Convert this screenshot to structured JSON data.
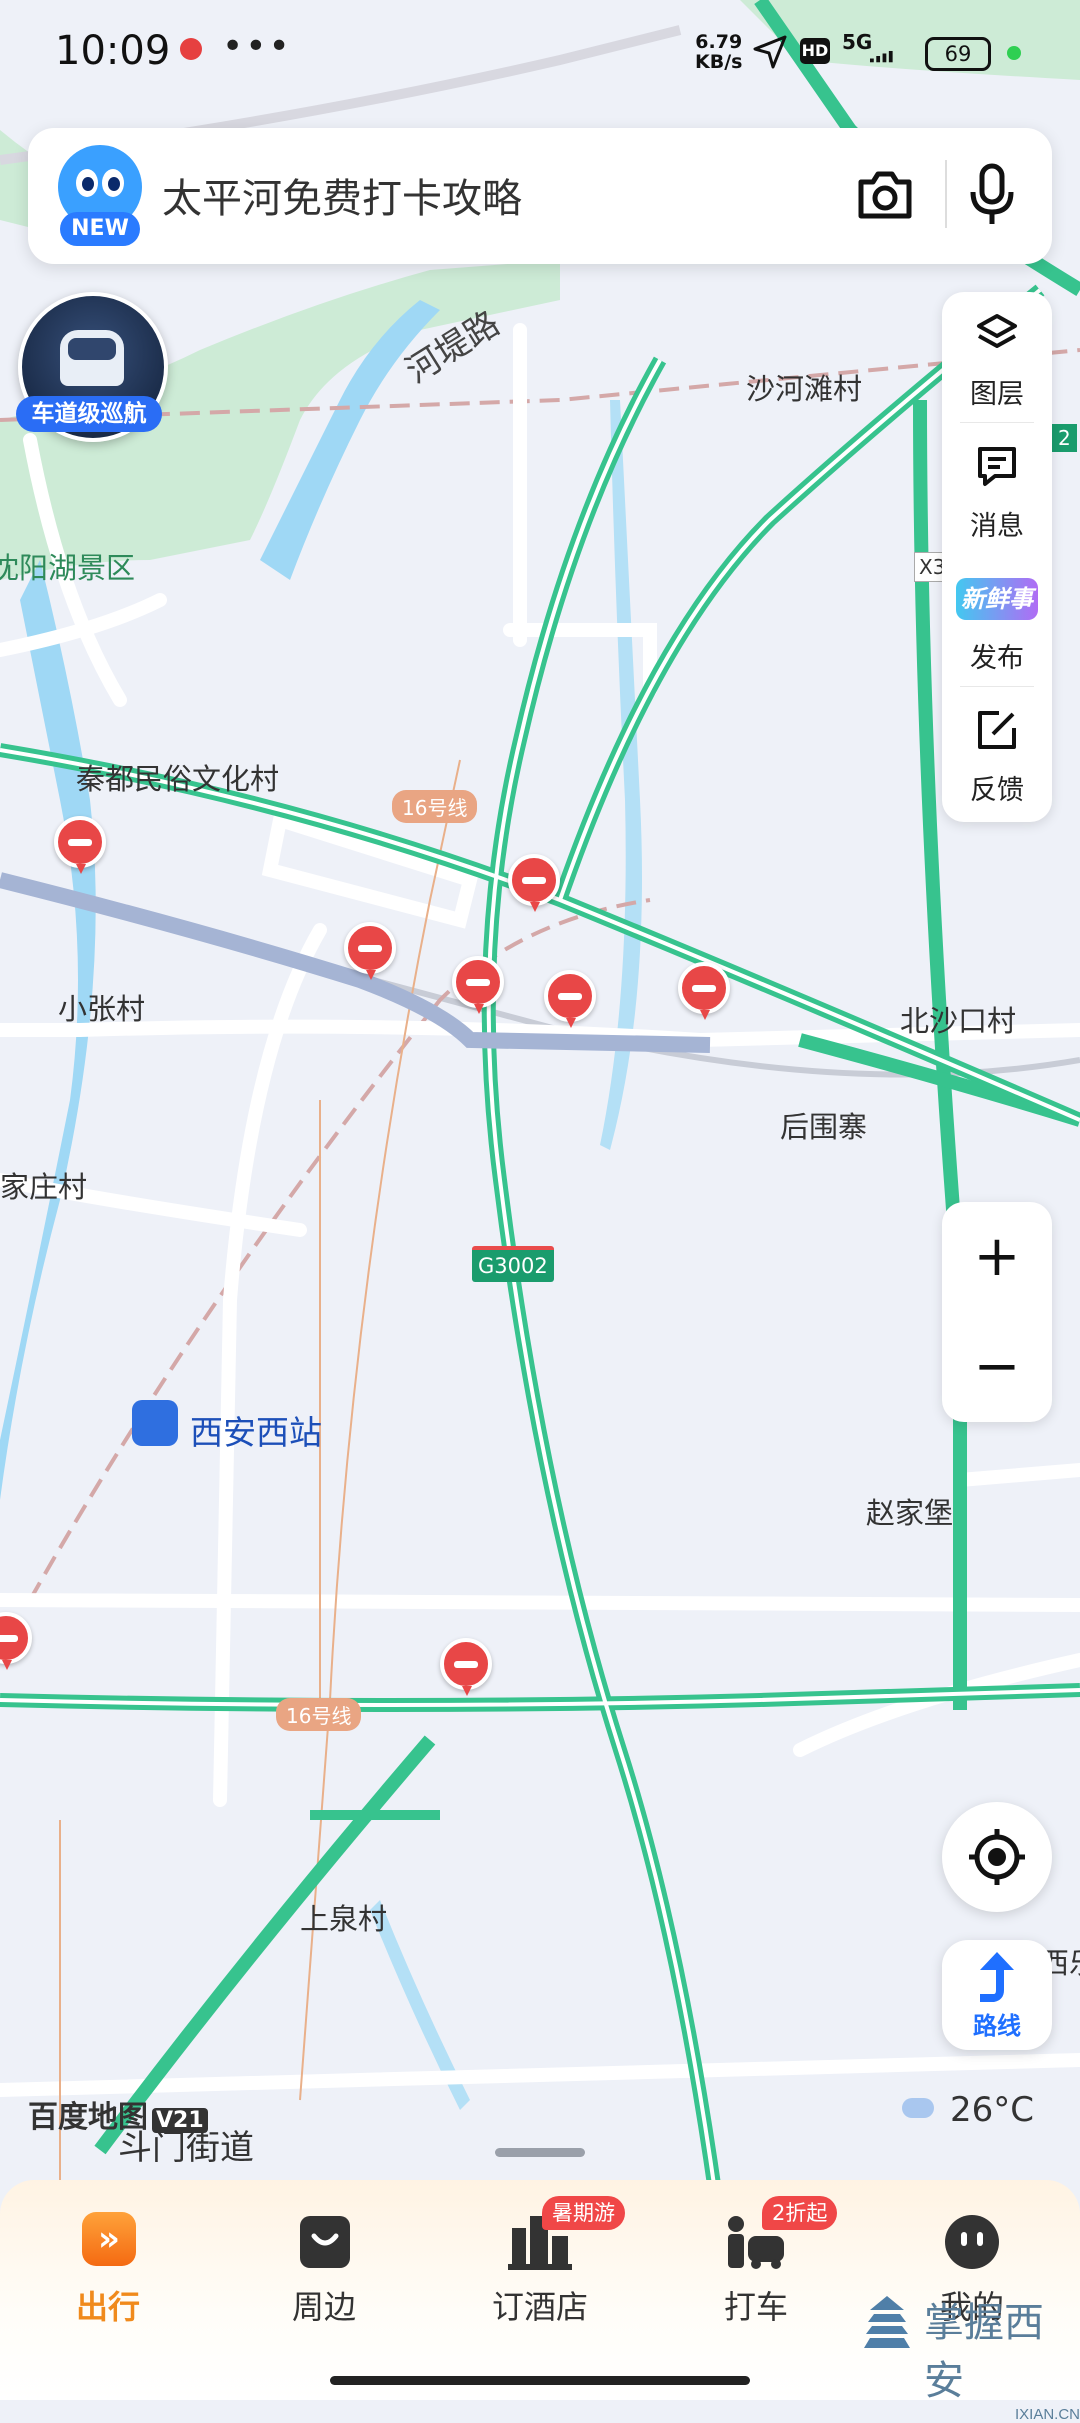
{
  "status_bar": {
    "time": "10:09",
    "net_speed_value": "6.79",
    "net_speed_unit": "KB/s",
    "hd": "HD",
    "network": "5G",
    "battery": "69"
  },
  "search": {
    "placeholder": "太平河免费打卡攻略",
    "mascot_badge": "NEW"
  },
  "car_nav": {
    "label": "车道级巡航"
  },
  "toolbar": {
    "items": [
      {
        "label": "图层",
        "icon": "layers-icon"
      },
      {
        "label": "消息",
        "icon": "message-icon"
      },
      {
        "label": "发布",
        "icon": "xinxianshi-icon",
        "brand_text": "新鲜事"
      },
      {
        "label": "反馈",
        "icon": "feedback-icon"
      }
    ]
  },
  "zoom": {
    "in": "+",
    "out": "−"
  },
  "route": {
    "label": "路线"
  },
  "weather": {
    "temperature": "26°C"
  },
  "brand": {
    "name": "百度地图",
    "version": "V21"
  },
  "map": {
    "labels": [
      "河堤路",
      "沙河滩村",
      "沈阳湖景区",
      "秦都民俗文化村",
      "小张村",
      "北沙口村",
      "后围寨",
      "家庄村",
      "西安西站",
      "赵家堡",
      "上泉村",
      "斗门街道",
      "西乐"
    ],
    "road_badges": {
      "line16_a": "16号线",
      "line16_b": "16号线",
      "highway": "G3002",
      "x_road": "X3",
      "edge": "2"
    }
  },
  "bottom_nav": {
    "tabs": [
      {
        "label": "出行",
        "active": true
      },
      {
        "label": "周边"
      },
      {
        "label": "订酒店",
        "badge": "暑期游"
      },
      {
        "label": "打车",
        "badge": "2折起"
      },
      {
        "label": "我的"
      }
    ]
  },
  "watermark": {
    "text": "掌握西安",
    "site": "IXIAN.CN"
  },
  "colors": {
    "highway": "#37c38e",
    "accent_blue": "#2a6df5",
    "active_tab": "#f08a1c",
    "badge_red": "#f04747"
  }
}
